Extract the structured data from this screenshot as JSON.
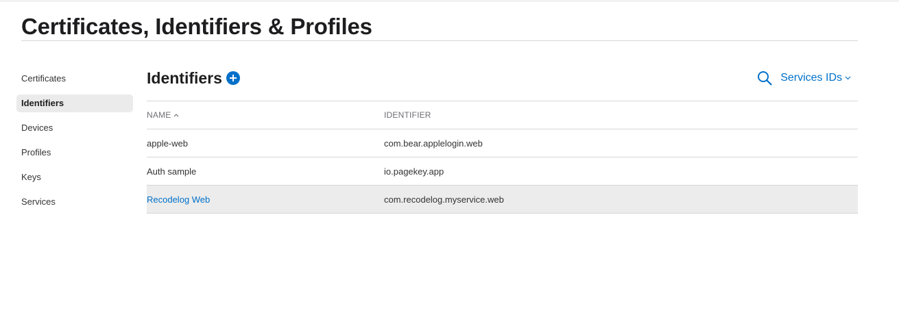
{
  "header": {
    "title": "Certificates, Identifiers & Profiles"
  },
  "sidebar": {
    "items": [
      {
        "label": "Certificates",
        "active": false
      },
      {
        "label": "Identifiers",
        "active": true
      },
      {
        "label": "Devices",
        "active": false
      },
      {
        "label": "Profiles",
        "active": false
      },
      {
        "label": "Keys",
        "active": false
      },
      {
        "label": "Services",
        "active": false
      }
    ]
  },
  "main": {
    "section_title": "Identifiers",
    "add_icon": "plus-circle-icon",
    "search_icon": "search-icon",
    "filter": {
      "selected": "Services IDs",
      "icon": "chevron-down-icon"
    },
    "table": {
      "columns": [
        "NAME",
        "IDENTIFIER"
      ],
      "sort_icon": "sort-ascending-icon",
      "rows": [
        {
          "name": "apple-web",
          "identifier": "com.bear.applelogin.web"
        },
        {
          "name": "Auth sample",
          "identifier": "io.pagekey.app"
        },
        {
          "name": "Recodelog Web",
          "identifier": "com.recodelog.myservice.web"
        }
      ]
    }
  },
  "colors": {
    "accent": "#0070c9",
    "text": "#1d1d1f",
    "muted": "#6e6e73",
    "divider": "#d6d6d6",
    "selected_bg": "#ebebeb"
  }
}
